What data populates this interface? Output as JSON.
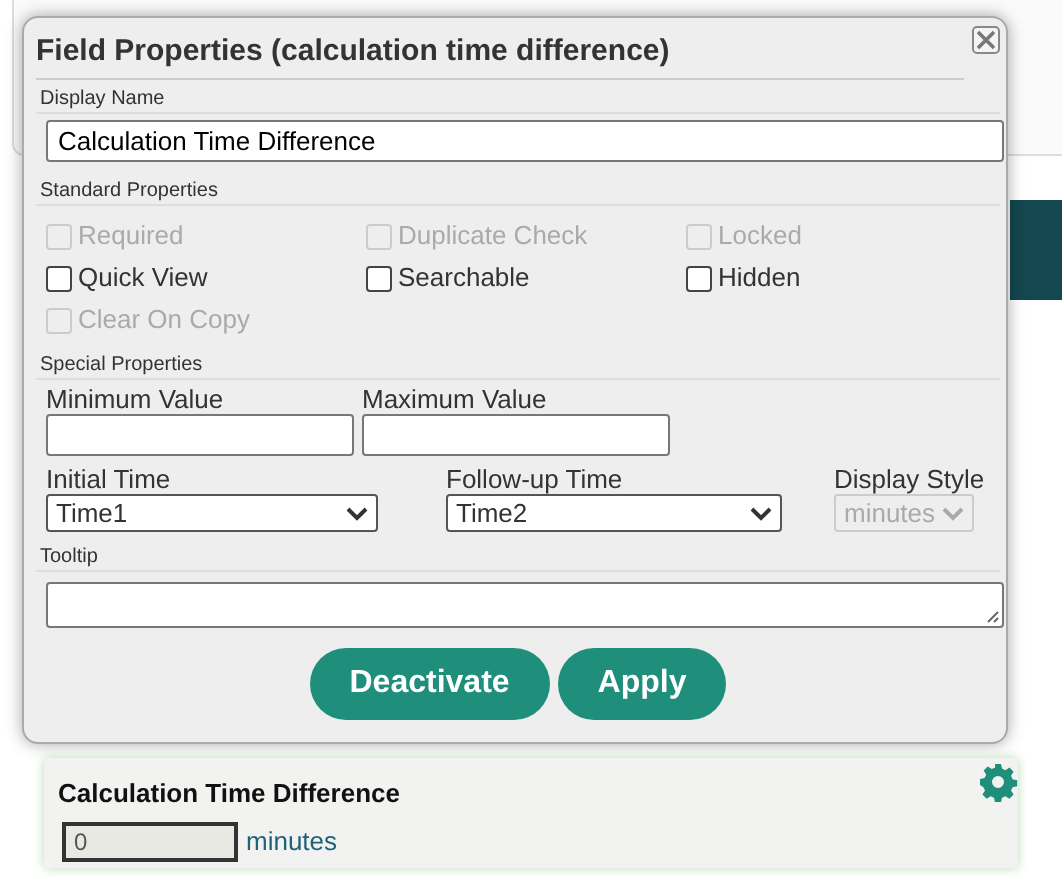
{
  "dialog": {
    "title": "Field Properties (calculation time difference)",
    "display_name": {
      "label": "Display Name",
      "value": "Calculation Time Difference"
    },
    "standard": {
      "label": "Standard Properties",
      "options": [
        {
          "label": "Required",
          "checked": false,
          "disabled": true
        },
        {
          "label": "Duplicate Check",
          "checked": false,
          "disabled": true
        },
        {
          "label": "Locked",
          "checked": false,
          "disabled": true
        },
        {
          "label": "Quick View",
          "checked": false,
          "disabled": false
        },
        {
          "label": "Searchable",
          "checked": false,
          "disabled": false
        },
        {
          "label": "Hidden",
          "checked": false,
          "disabled": false
        },
        {
          "label": "Clear On Copy",
          "checked": false,
          "disabled": true
        }
      ]
    },
    "special": {
      "label": "Special Properties",
      "minimum": {
        "label": "Minimum Value"
      },
      "maximum": {
        "label": "Maximum Value"
      },
      "initial_time": {
        "label": "Initial Time",
        "value": "Time1"
      },
      "followup_time": {
        "label": "Follow-up Time",
        "value": "Time2"
      },
      "display_style": {
        "label": "Display Style",
        "value": "minutes",
        "disabled": true
      }
    },
    "tooltip": {
      "label": "Tooltip"
    },
    "buttons": [
      "Deactivate",
      "Apply"
    ]
  },
  "field_card": {
    "title": "Calculation Time Difference",
    "value": "0",
    "unit": "minutes"
  }
}
